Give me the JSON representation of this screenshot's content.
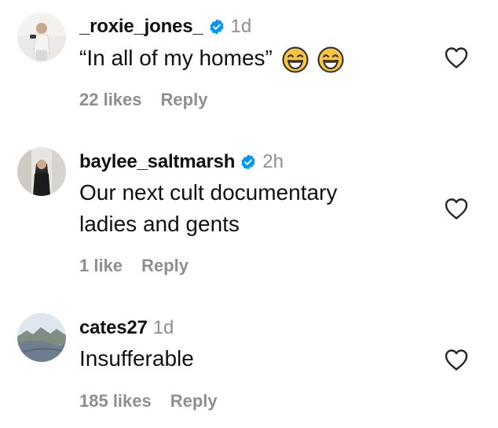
{
  "comments": [
    {
      "username": "_roxie_jones_",
      "verified": true,
      "time": "1d",
      "text": "“In all of my homes”",
      "emoji": "face-with-tears-of-joy-icon",
      "likes": "22 likes",
      "reply_label": "Reply"
    },
    {
      "username": "baylee_saltmarsh",
      "verified": true,
      "time": "2h",
      "text_lines": [
        "Our next cult documentary",
        "ladies and gents"
      ],
      "likes": "1 like",
      "reply_label": "Reply"
    },
    {
      "username": "cates27",
      "verified": false,
      "time": "1d",
      "text": "Insufferable",
      "likes": "185 likes",
      "reply_label": "Reply"
    }
  ],
  "colors": {
    "text": "#111111",
    "muted": "#8e8e8e",
    "verified_badge": "#0095f6",
    "emoji_face": "#f9c440"
  },
  "icons": {
    "like": "heart-outline-icon",
    "verified": "verified-badge-icon"
  }
}
